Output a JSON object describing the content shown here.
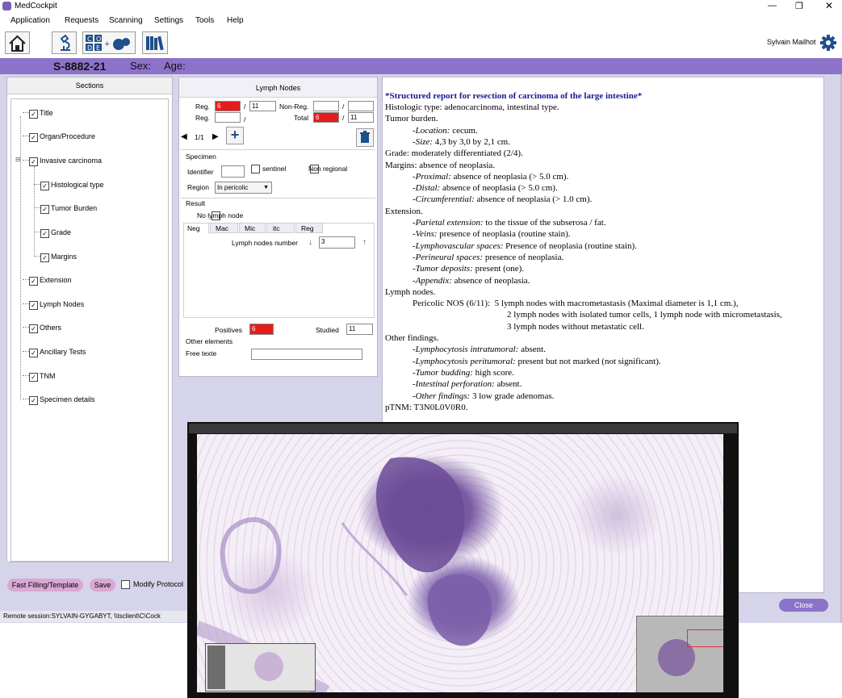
{
  "window": {
    "title": "MedCockpit",
    "controls": [
      "—",
      "❐",
      "✕"
    ]
  },
  "menu": [
    "Application",
    "Requests",
    "Scanning",
    "Settings",
    "Tools",
    "Help"
  ],
  "user": {
    "name": "Sylvain Mailhot"
  },
  "patient": {
    "case_id": "S-8882-21",
    "sex_label": "Sex:",
    "age_label": "Age:"
  },
  "sections": {
    "header": "Sections",
    "items": [
      {
        "label": "Title",
        "checked": true,
        "level": 0
      },
      {
        "label": "Organ/Procedure",
        "checked": true,
        "level": 0
      },
      {
        "label": "Invasive carcinoma",
        "checked": true,
        "level": 0
      },
      {
        "label": "Histological type",
        "checked": true,
        "level": 1
      },
      {
        "label": "Tumor Burden",
        "checked": true,
        "level": 1
      },
      {
        "label": "Grade",
        "checked": true,
        "level": 1
      },
      {
        "label": "Margins",
        "checked": true,
        "level": 1
      },
      {
        "label": "Extension",
        "checked": true,
        "level": 0
      },
      {
        "label": "Lymph Nodes",
        "checked": true,
        "level": 0
      },
      {
        "label": "Others",
        "checked": true,
        "level": 0
      },
      {
        "label": "Ancillary Tests",
        "checked": true,
        "level": 0
      },
      {
        "label": "TNM",
        "checked": true,
        "level": 0
      },
      {
        "label": "Specimen details",
        "checked": true,
        "level": 0
      }
    ]
  },
  "form": {
    "header": "Lymph Nodes",
    "reg_label": "Reg.",
    "reg_pos": "6",
    "reg_total": "11",
    "nonreg_label": "Non-Reg.",
    "nonreg_pos": "",
    "nonreg_total": "",
    "reg2_label": "Reg.",
    "total_label": "Total",
    "total_pos": "6",
    "total_total": "11",
    "slash": "/",
    "pager": "1/1",
    "specimen_head": "Specimen",
    "identifier_label": "Identifier",
    "sentinel_label": "sentinel",
    "nonregional_label": "Non regional",
    "region_label": "Region",
    "region_value": "In pericolic",
    "result_head": "Result",
    "no_lymph_label": "No lymph node",
    "tabs": [
      "Neg",
      "Mac",
      "Mic",
      "itc",
      "Reg"
    ],
    "ln_number_label": "Lymph nodes number",
    "ln_number_value": "3",
    "positives_label": "Positives",
    "positives_value": "6",
    "studied_label": "Studied",
    "studied_value": "11",
    "other_head": "Other elements",
    "free_text_label": "Free texte",
    "free_text_value": ""
  },
  "report": {
    "title": "*Structured report for resection of carcinoma of the large intestine*",
    "lines": [
      {
        "indent": 0,
        "k": "",
        "v": "Histologic type: adenocarcinoma, intestinal type."
      },
      {
        "indent": 0,
        "k": "",
        "v": "Tumor burden."
      },
      {
        "indent": 1,
        "k": "-Location:",
        "v": " cecum."
      },
      {
        "indent": 1,
        "k": "-Size:",
        "v": " 4,3 by 3,0 by 2,1 cm."
      },
      {
        "indent": 0,
        "k": "",
        "v": "Grade: moderately differentiated (2/4)."
      },
      {
        "indent": 0,
        "k": "",
        "v": "Margins: absence of neoplasia."
      },
      {
        "indent": 1,
        "k": "-Proximal:",
        "v": " absence of neoplasia (> 5.0 cm)."
      },
      {
        "indent": 1,
        "k": "-Distal:",
        "v": " absence of neoplasia (> 5.0 cm)."
      },
      {
        "indent": 1,
        "k": "-Circumferential:",
        "v": " absence of neoplasia (> 1.0 cm)."
      },
      {
        "indent": 0,
        "k": "",
        "v": "Extension."
      },
      {
        "indent": 1,
        "k": "-Parietal extension:",
        "v": " to the tissue of the subserosa / fat."
      },
      {
        "indent": 1,
        "k": "-Veins:",
        "v": " presence of neoplasia (routine stain)."
      },
      {
        "indent": 1,
        "k": "-Lymphovascular spaces:",
        "v": " Presence of neoplasia (routine stain)."
      },
      {
        "indent": 1,
        "k": "-Perineural spaces:",
        "v": " presence of neoplasia."
      },
      {
        "indent": 1,
        "k": "-Tumor deposits:",
        "v": " present (one)."
      },
      {
        "indent": 1,
        "k": "-Appendix:",
        "v": " absence of neoplasia."
      },
      {
        "indent": 0,
        "k": "",
        "v": "Lymph nodes."
      },
      {
        "indent": 2,
        "k": "",
        "v": "Pericolic NOS (6/11):  5 lymph nodes with macrometastasis (Maximal diameter is 1,1 cm.),"
      },
      {
        "indent": 3,
        "k": "",
        "v": "2 lymph nodes with isolated tumor cells, 1 lymph node with micrometastasis,"
      },
      {
        "indent": 3,
        "k": "",
        "v": "3 lymph nodes without metastatic cell."
      },
      {
        "indent": 0,
        "k": "",
        "v": "Other findings."
      },
      {
        "indent": 1,
        "k": "-Lymphocytosis intratumoral:",
        "v": " absent."
      },
      {
        "indent": 1,
        "k": "-Lymphocytosis peritumoral:",
        "v": " present but not marked (not significant)."
      },
      {
        "indent": 1,
        "k": "-Tumor budding:",
        "v": " high score."
      },
      {
        "indent": 1,
        "k": "-Intestinal perforation:",
        "v": " absent."
      },
      {
        "indent": 1,
        "k": "-Other findings:",
        "v": " 3 low grade adenomas."
      },
      {
        "indent": 0,
        "k": "",
        "v": "pTNM: T3N0L0V0R0."
      }
    ]
  },
  "bottom": {
    "fast_filling": "Fast Filling/Template",
    "save": "Save",
    "modify_protocol": "Modify Protocol",
    "close": "Close",
    "status": "Remote session:SYLVAIN-GYGABYT, \\\\tsclient\\C\\Cock"
  },
  "colors": {
    "accent": "#8c73c9",
    "panel_bg": "#d6d4ea",
    "button": "#d9a8d4",
    "alert": "#e51c1c",
    "report_title": "#1a1a8c"
  }
}
